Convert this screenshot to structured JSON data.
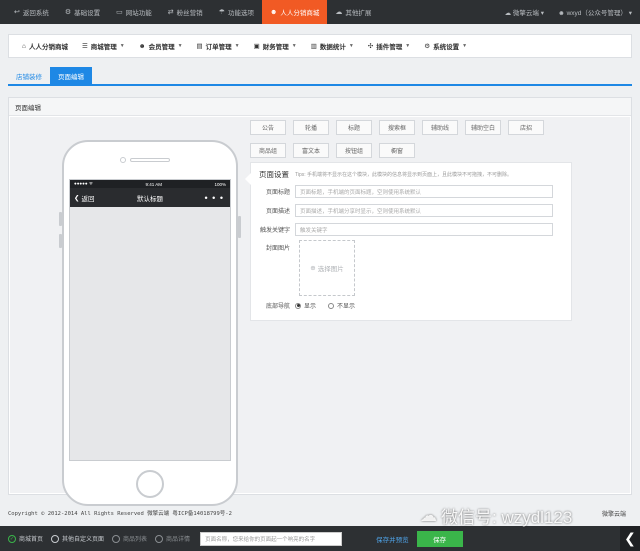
{
  "topnav": {
    "items": [
      {
        "icon": "reply-icon",
        "label": "返回系统"
      },
      {
        "icon": "cog-icon",
        "label": "基础设置"
      },
      {
        "icon": "desktop-icon",
        "label": "网站功能"
      },
      {
        "icon": "share-icon",
        "label": "粉丝营销"
      },
      {
        "icon": "umbrella-icon",
        "label": "功能选项"
      },
      {
        "icon": "user-icon",
        "label": "人人分销商城"
      },
      {
        "icon": "cloud-icon",
        "label": "其他扩展"
      }
    ],
    "active_index": 5,
    "right": {
      "platform": "微擎云端",
      "account": "wxyd（公众号管理）"
    }
  },
  "menubar": {
    "items": [
      {
        "icon": "home-icon",
        "label": "人人分销商城"
      },
      {
        "icon": "list-icon",
        "label": "商城管理"
      },
      {
        "icon": "users-icon",
        "label": "会员管理"
      },
      {
        "icon": "file-icon",
        "label": "订单管理"
      },
      {
        "icon": "money-icon",
        "label": "财务管理"
      },
      {
        "icon": "chart-icon",
        "label": "数据统计"
      },
      {
        "icon": "puzzle-icon",
        "label": "插件管理"
      },
      {
        "icon": "gear-icon",
        "label": "系统设置"
      }
    ]
  },
  "tabs": [
    {
      "label": "店铺装修",
      "active": false
    },
    {
      "label": "页面编辑",
      "active": true
    }
  ],
  "panel": {
    "title": "页面编辑"
  },
  "phone": {
    "status_left": "●●●●● ᯤ",
    "status_time": "9:41 AM",
    "status_right": "100%",
    "back_label": "返回",
    "title": "默认标题",
    "more": "• • •"
  },
  "components": [
    [
      "公告",
      "轮播",
      "标题",
      "搜索框",
      "辅助线",
      "辅助空白",
      "店招"
    ],
    [
      "商品组",
      "富文本",
      "按钮组",
      "橱窗"
    ]
  ],
  "settings": {
    "title": "页面设置",
    "tip": "Tips: 手机端将不显示在这个模块，此模块的信息将显示到页面上，且此模块不可拖拽，不可删除。",
    "fields": [
      {
        "label": "页面标题",
        "placeholder": "页面标题，手机端的页面标题，空则使用系统默认"
      },
      {
        "label": "页面描述",
        "placeholder": "页面描述，手机端分享时显示，空则使用系统默认"
      },
      {
        "label": "触发关键字",
        "placeholder": "触发关键字"
      }
    ],
    "cover_label": "封面图片",
    "cover_button": "选择图片",
    "bottom_nav_label": "底部导航",
    "radio_options": [
      "显示",
      "不显示"
    ],
    "radio_selected": 0
  },
  "footer": {
    "copyright": "Copyright © 2012-2014 All Rights Reserved 微擎云端 粤ICP备14018799号-2",
    "brand": "微擎云端"
  },
  "actionbar": {
    "options": [
      {
        "label": "商城首页",
        "state": "checked"
      },
      {
        "label": "其他自定义页面",
        "state": "unchecked"
      },
      {
        "label": "商品列表",
        "state": "dim"
      },
      {
        "label": "商品详情",
        "state": "dim"
      }
    ],
    "name_placeholder": "页面名称，您来给你的页面起一个响亮的名字",
    "save_preview": "保存并预览",
    "save": "保存"
  },
  "watermark": "微信号: wzydl123",
  "collapse_glyph": "❮"
}
